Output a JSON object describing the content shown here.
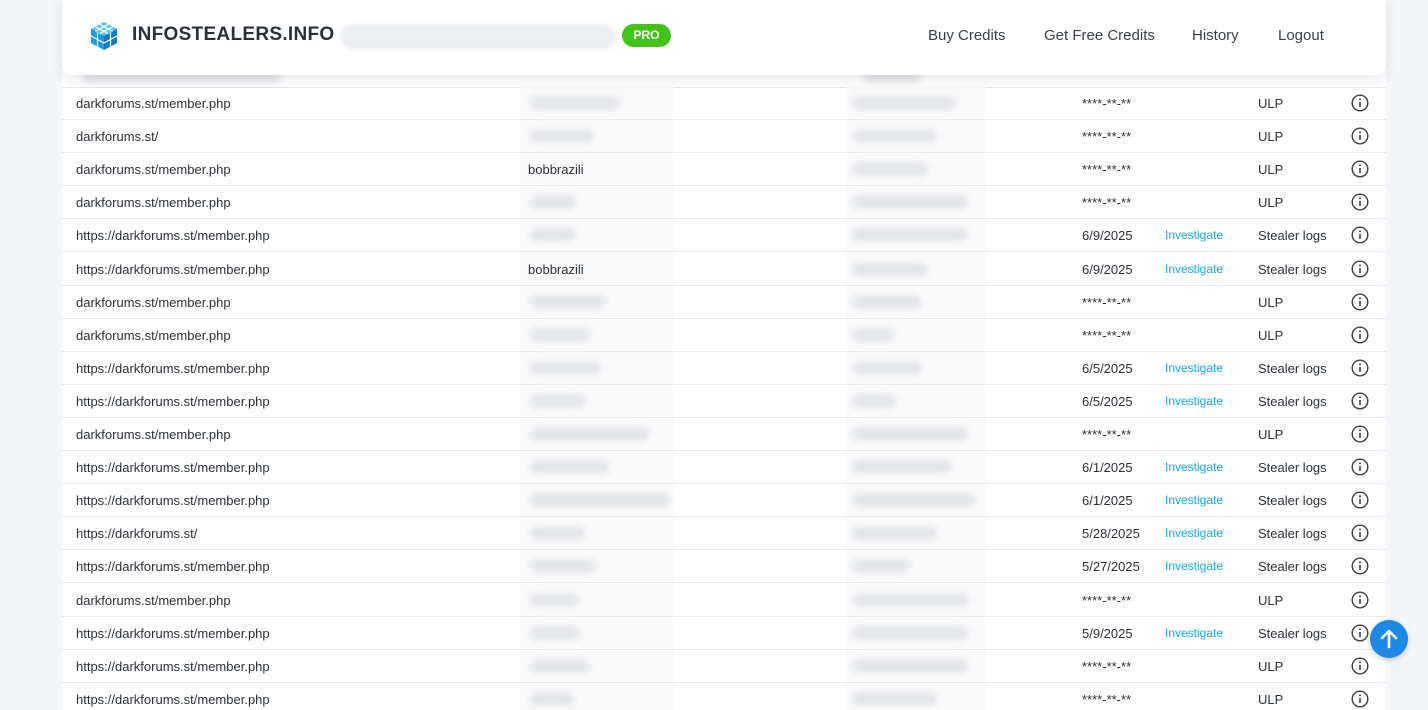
{
  "header": {
    "brand": "INFOSTEALERS.INFO",
    "badge": "PRO",
    "nav": [
      "Buy Credits",
      "Get Free Credits",
      "History",
      "Logout"
    ]
  },
  "actions": {
    "investigate_label": "Investigate"
  },
  "rows": [
    {
      "url": "darkforums.st/member.php",
      "user": "",
      "date": "****-**-**",
      "investigate": false,
      "type": "ULP"
    },
    {
      "url": "darkforums.st/",
      "user": "",
      "date": "****-**-**",
      "investigate": false,
      "type": "ULP"
    },
    {
      "url": "darkforums.st/member.php",
      "user": "bobbrazili",
      "date": "****-**-**",
      "investigate": false,
      "type": "ULP"
    },
    {
      "url": "darkforums.st/member.php",
      "user": "",
      "date": "****-**-**",
      "investigate": false,
      "type": "ULP"
    },
    {
      "url": "https://darkforums.st/member.php",
      "user": "",
      "date": "6/9/2025",
      "investigate": true,
      "type": "Stealer logs"
    },
    {
      "url": "https://darkforums.st/member.php",
      "user": "bobbrazili",
      "date": "6/9/2025",
      "investigate": true,
      "type": "Stealer logs"
    },
    {
      "url": "darkforums.st/member.php",
      "user": "",
      "date": "****-**-**",
      "investigate": false,
      "type": "ULP"
    },
    {
      "url": "darkforums.st/member.php",
      "user": "",
      "date": "****-**-**",
      "investigate": false,
      "type": "ULP"
    },
    {
      "url": "https://darkforums.st/member.php",
      "user": "",
      "date": "6/5/2025",
      "investigate": true,
      "type": "Stealer logs"
    },
    {
      "url": "https://darkforums.st/member.php",
      "user": "",
      "date": "6/5/2025",
      "investigate": true,
      "type": "Stealer logs"
    },
    {
      "url": "darkforums.st/member.php",
      "user": "",
      "date": "****-**-**",
      "investigate": false,
      "type": "ULP"
    },
    {
      "url": "https://darkforums.st/member.php",
      "user": "",
      "date": "6/1/2025",
      "investigate": true,
      "type": "Stealer logs"
    },
    {
      "url": "https://darkforums.st/member.php",
      "user": "",
      "date": "6/1/2025",
      "investigate": true,
      "type": "Stealer logs"
    },
    {
      "url": "https://darkforums.st/",
      "user": "",
      "date": "5/28/2025",
      "investigate": true,
      "type": "Stealer logs"
    },
    {
      "url": "https://darkforums.st/member.php",
      "user": "",
      "date": "5/27/2025",
      "investigate": true,
      "type": "Stealer logs"
    },
    {
      "url": "darkforums.st/member.php",
      "user": "",
      "date": "****-**-**",
      "investigate": false,
      "type": "ULP"
    },
    {
      "url": "https://darkforums.st/member.php",
      "user": "",
      "date": "5/9/2025",
      "investigate": true,
      "type": "Stealer logs"
    },
    {
      "url": "https://darkforums.st/member.php",
      "user": "",
      "date": "****-**-**",
      "investigate": false,
      "type": "ULP"
    },
    {
      "url": "https://darkforums.st/member.php",
      "user": "",
      "date": "****-**-**",
      "investigate": false,
      "type": "ULP"
    }
  ],
  "icons": {
    "logo": "cube-logo-icon",
    "info": "info-circle-icon",
    "scroll": "arrow-up-icon"
  },
  "colors": {
    "accent": "#1aa6e8",
    "pro": "#45c21a",
    "scroll_button": "#1e88e5"
  }
}
